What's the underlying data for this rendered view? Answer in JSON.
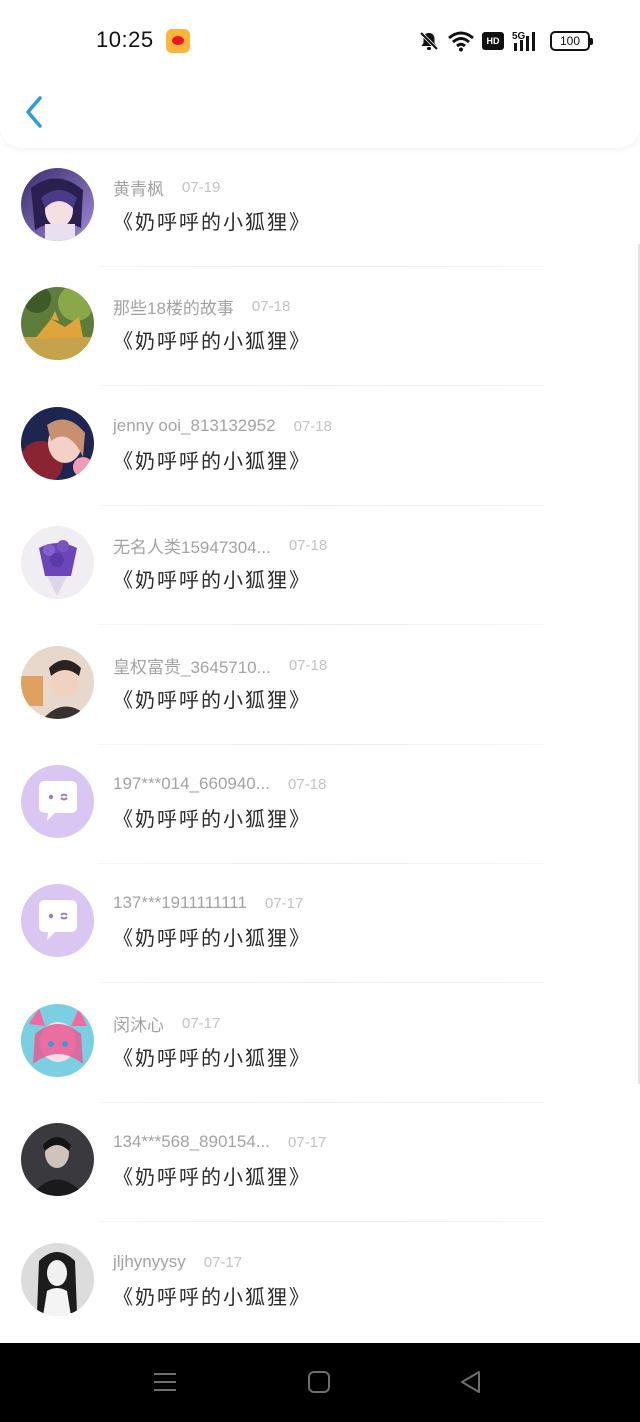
{
  "status_bar": {
    "time": "10:25",
    "icons": [
      "weibo-icon",
      "bell-off-icon",
      "wifi-icon",
      "hd-icon",
      "signal-5g-icon",
      "battery-icon"
    ],
    "hd_label": "HD",
    "network_label": "5G",
    "battery_level": "100"
  },
  "header": {
    "back_icon": "chevron-left-icon",
    "accent_color": "#2b9be6"
  },
  "list": {
    "items": [
      {
        "name": "黄青枫",
        "date": "07-19",
        "title": "《奶呼呼的小狐狸》",
        "avatar": "anime-girl-purple"
      },
      {
        "name": "那些18楼的故事",
        "date": "07-18",
        "title": "《奶呼呼的小狐狸》",
        "avatar": "fox-garden"
      },
      {
        "name": "jenny ooi_813132952",
        "date": "07-18",
        "title": "《奶呼呼的小狐狸》",
        "avatar": "anime-couple"
      },
      {
        "name": "无名人类15947304...",
        "date": "07-18",
        "title": "《奶呼呼的小狐狸》",
        "avatar": "lavender-bouquet"
      },
      {
        "name": "皇权富贵_3645710...",
        "date": "07-18",
        "title": "《奶呼呼的小狐狸》",
        "avatar": "young-man"
      },
      {
        "name": "197***014_660940...",
        "date": "07-18",
        "title": "《奶呼呼的小狐狸》",
        "avatar": "default-chat"
      },
      {
        "name": "137***1911111111",
        "date": "07-17",
        "title": "《奶呼呼的小狐狸》",
        "avatar": "default-chat"
      },
      {
        "name": "闵沐心",
        "date": "07-17",
        "title": "《奶呼呼的小狐狸》",
        "avatar": "pink-anime-girl"
      },
      {
        "name": "134***568_890154...",
        "date": "07-17",
        "title": "《奶呼呼的小狐狸》",
        "avatar": "dark-man"
      },
      {
        "name": "jljhynyysy",
        "date": "07-17",
        "title": "《奶呼呼的小狐狸》",
        "avatar": "bw-girl"
      }
    ]
  },
  "nav_bar": {
    "icons": [
      "menu-icon",
      "home-icon",
      "back-triangle-icon"
    ]
  }
}
